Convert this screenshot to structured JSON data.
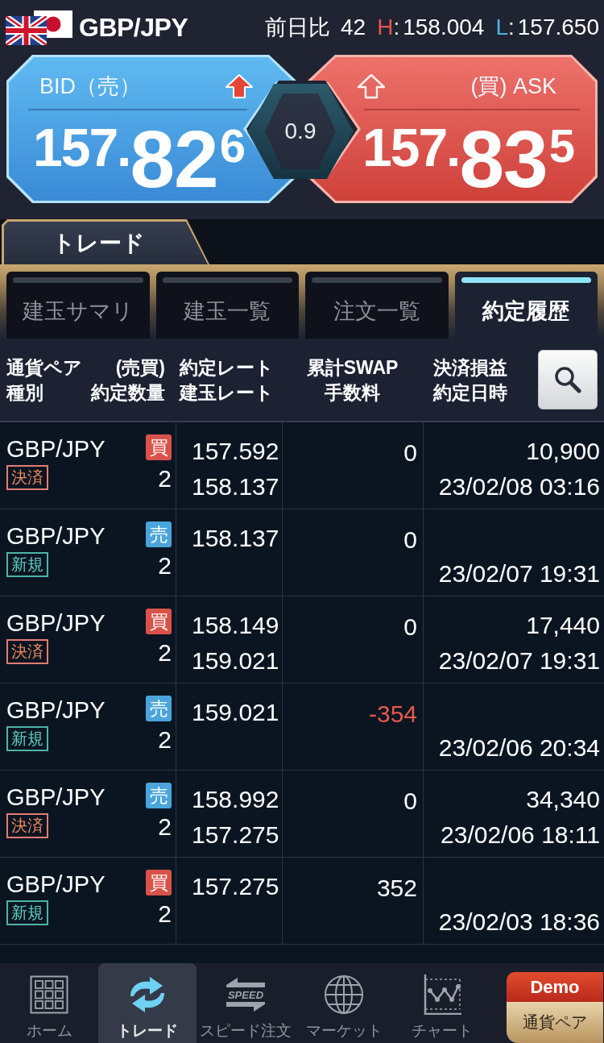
{
  "header": {
    "pair": "GBP/JPY",
    "change": {
      "label": "前日比",
      "value": "42"
    },
    "high": {
      "letter": "H",
      "separator": ":",
      "value": "158.004"
    },
    "low": {
      "letter": "L",
      "separator": ":",
      "value": "157.650"
    }
  },
  "quotes": [
    {
      "kind": "bid",
      "label": "BID（売）",
      "arrow": {
        "kind": "up",
        "filled": true
      },
      "price": {
        "head": "157.",
        "pips": "82",
        "fraction": "6"
      }
    },
    {
      "kind": "ask",
      "label": "(買) ASK",
      "arrow": {
        "kind": "up",
        "filled": false
      },
      "price": {
        "head": "157.",
        "pips": "83",
        "fraction": "5"
      }
    }
  ],
  "spread": "0.9",
  "section_tab": {
    "label": "トレード"
  },
  "tabs": [
    {
      "label": "建玉サマリ",
      "selected": false
    },
    {
      "label": "建玉一覧",
      "selected": false
    },
    {
      "label": "注文一覧",
      "selected": false
    },
    {
      "label": "約定履歴",
      "selected": true
    }
  ],
  "columns": [
    {
      "lines": [
        "通貨ペア",
        "種別"
      ]
    },
    {
      "lines": [
        "(売買)",
        "約定数量"
      ]
    },
    {
      "lines": [
        "約定レート",
        "建玉レート"
      ]
    },
    {
      "lines": [
        "累計SWAP",
        "手数料"
      ]
    },
    {
      "lines": [
        "決済損益",
        "約定日時"
      ]
    }
  ],
  "rows": [
    {
      "pair": "GBP/JPY",
      "side": {
        "text": "買",
        "kind": "buy"
      },
      "type": {
        "text": "決済",
        "kind": "close"
      },
      "quantity": "2",
      "rate": "157.592",
      "position_rate": "158.137",
      "swap": "0",
      "negative": false,
      "profit": "10,900",
      "datetime": "23/02/08 03:16"
    },
    {
      "pair": "GBP/JPY",
      "side": {
        "text": "売",
        "kind": "sell"
      },
      "type": {
        "text": "新規",
        "kind": "open"
      },
      "quantity": "2",
      "rate": "158.137",
      "swap": "0",
      "negative": false,
      "datetime": "23/02/07 19:31"
    },
    {
      "pair": "GBP/JPY",
      "side": {
        "text": "買",
        "kind": "buy"
      },
      "type": {
        "text": "決済",
        "kind": "close"
      },
      "quantity": "2",
      "rate": "158.149",
      "position_rate": "159.021",
      "swap": "0",
      "negative": false,
      "profit": "17,440",
      "datetime": "23/02/07 19:31"
    },
    {
      "pair": "GBP/JPY",
      "side": {
        "text": "売",
        "kind": "sell"
      },
      "type": {
        "text": "新規",
        "kind": "open"
      },
      "quantity": "2",
      "rate": "159.021",
      "swap": "-354",
      "negative": true,
      "datetime": "23/02/06 20:34"
    },
    {
      "pair": "GBP/JPY",
      "side": {
        "text": "売",
        "kind": "sell"
      },
      "type": {
        "text": "決済",
        "kind": "close"
      },
      "quantity": "2",
      "rate": "158.992",
      "position_rate": "157.275",
      "swap": "0",
      "negative": false,
      "profit": "34,340",
      "datetime": "23/02/06 18:11"
    },
    {
      "pair": "GBP/JPY",
      "side": {
        "text": "買",
        "kind": "buy"
      },
      "type": {
        "text": "新規",
        "kind": "open"
      },
      "quantity": "2",
      "rate": "157.275",
      "swap": "352",
      "negative": false,
      "datetime": "23/02/03 18:36"
    }
  ],
  "bottom_nav": {
    "items": [
      {
        "kind": "grid",
        "label": "ホーム",
        "selected": false
      },
      {
        "kind": "cycle",
        "label": "トレード",
        "selected": true
      },
      {
        "kind": "speed",
        "label": "スピード注文",
        "icon_text": "SPEED",
        "selected": false
      },
      {
        "kind": "globe",
        "label": "マーケット",
        "selected": false
      },
      {
        "kind": "chart",
        "label": "チャート",
        "selected": false
      }
    ],
    "demo": {
      "badge": "Demo",
      "button": "通貨ペア"
    }
  }
}
